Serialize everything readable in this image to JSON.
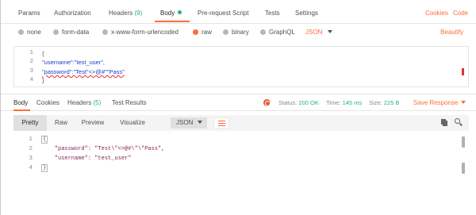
{
  "request_tabs": [
    {
      "label": "Params"
    },
    {
      "label": "Authorization"
    },
    {
      "label": "Headers",
      "count": "(9)"
    },
    {
      "label": "Body"
    },
    {
      "label": "Pre-request Script"
    },
    {
      "label": "Tests"
    },
    {
      "label": "Settings"
    }
  ],
  "header_links": {
    "cookies": "Cookies",
    "code": "Code"
  },
  "body_types": [
    "none",
    "form-data",
    "x-www-form-urlencoded",
    "raw",
    "binary",
    "GraphQL"
  ],
  "selected_body_type": "raw",
  "body_format": "JSON",
  "beautify": "Beautify",
  "request_body": {
    "line_numbers": [
      "1",
      "2",
      "3",
      "4"
    ],
    "lines": [
      "{",
      "\"username\":\"test_user\",",
      "\"password\":\"Test\"<>@#\"\"Pass\"",
      "}"
    ]
  },
  "response_tabs": [
    {
      "label": "Body"
    },
    {
      "label": "Cookies"
    },
    {
      "label": "Headers",
      "count": "(5)"
    },
    {
      "label": "Test Results"
    }
  ],
  "status": {
    "label": "Status:",
    "value": "200 OK"
  },
  "time": {
    "label": "Time:",
    "value": "145 ms"
  },
  "size": {
    "label": "Size:",
    "value": "225 B"
  },
  "save_response": "Save Response",
  "view_modes": [
    "Pretty",
    "Raw",
    "Preview",
    "Visualize"
  ],
  "response_format": "JSON",
  "response_body": {
    "line_numbers": [
      "1",
      "2",
      "3",
      "4"
    ],
    "lines": [
      "{",
      "    \"password\": \"Test\\\"<>@#\\\"\\\"Pass\",",
      "    \"username\": \"test_user\"",
      "}"
    ]
  },
  "colors": {
    "accent": "#ff6c37",
    "success": "#26b47f"
  }
}
